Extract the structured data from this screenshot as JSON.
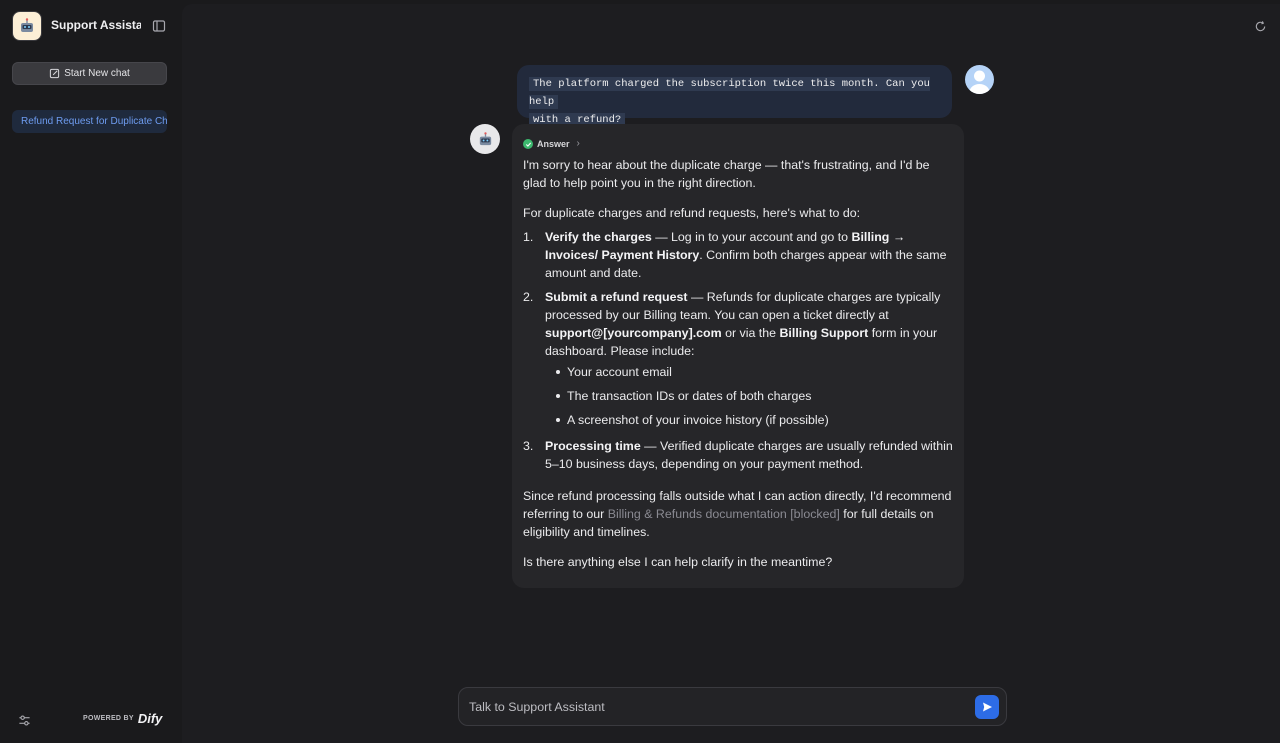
{
  "app": {
    "name": "Support Assistant",
    "logo_icon": "robot-icon"
  },
  "sidebar": {
    "new_chat_label": "Start New chat",
    "conversations": [
      {
        "label": "Refund Request for Duplicate Charge",
        "active": true
      }
    ],
    "powered_by_label": "POWERED BY",
    "brand": "Dify"
  },
  "chat": {
    "user_message": {
      "line1": "The platform charged the subscription twice this month. Can you help",
      "line2": "with a refund?"
    },
    "bot_message": {
      "status_label": "Answer",
      "intro": "I'm sorry to hear about the duplicate charge — that's frustrating, and I'd be glad to help point you in the right direction.",
      "lead": "For duplicate charges and refund requests, here's what to do:",
      "steps": [
        {
          "num": "1.",
          "title": "Verify the charges",
          "pre": " — Log in to your account and go to ",
          "bold2": "Billing → Invoices/ Payment History",
          "post": ". Confirm both charges appear with the same amount and date."
        },
        {
          "num": "2.",
          "title": "Submit a refund request",
          "pre": " — Refunds for duplicate charges are typically processed by our Billing team. You can open a ticket directly at ",
          "bold2": "support@[yourcompany].com",
          "mid": " or via the ",
          "bold3": "Billing Support",
          "post": " form in your dashboard. Please include:",
          "bullets": [
            "Your account email",
            "The transaction IDs or dates of both charges",
            "A screenshot of your invoice history (if possible)"
          ]
        },
        {
          "num": "3.",
          "title": "Processing time",
          "post": " — Verified duplicate charges are usually refunded within 5–10 business days, depending on your payment method."
        }
      ],
      "closing_pre": "Since refund processing falls outside what I can action directly, I'd recommend referring to our ",
      "closing_link": "Billing & Refunds documentation [blocked]",
      "closing_post": " for full details on eligibility and timelines.",
      "final": "Is there anything else I can help clarify in the meantime?"
    }
  },
  "input": {
    "placeholder": "Talk to Support Assistant"
  },
  "colors": {
    "accent": "#2d6ce6",
    "active_conv_text": "#6e9cf0",
    "success": "#3cb86e"
  }
}
